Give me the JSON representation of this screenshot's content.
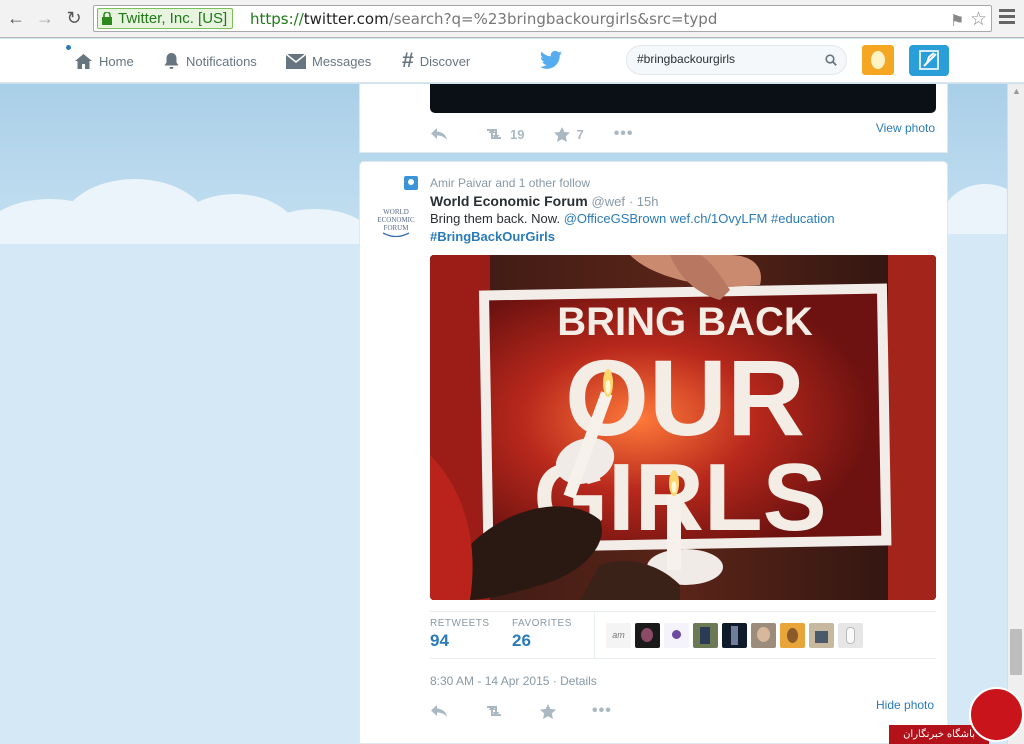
{
  "browser": {
    "ev_label": "Twitter, Inc. [US]",
    "url_scheme": "https://",
    "url_host": "twitter.com",
    "url_path": "/search?q=%23bringbackourgirls&src=typd",
    "back_icon": "back-arrow-icon",
    "forward_icon": "forward-arrow-icon",
    "reload_icon": "reload-icon"
  },
  "twitter_nav": {
    "items": [
      {
        "label": "Home",
        "icon": "home-icon"
      },
      {
        "label": "Notifications",
        "icon": "bell-icon"
      },
      {
        "label": "Messages",
        "icon": "envelope-icon"
      },
      {
        "label": "Discover",
        "icon": "hashtag-icon"
      }
    ],
    "search_value": "#bringbackourgirls",
    "brand_color": "#55acee",
    "compose_color": "#2a9ed8"
  },
  "tweet_prev": {
    "retweets": "19",
    "favorites": "7",
    "view_photo": "View photo"
  },
  "tweet": {
    "context": "Amir Paivar and 1 other follow",
    "logo_text": "WORLD ECONOMIC FORUM",
    "name": "World Economic Forum",
    "handle": "@wef",
    "time": "· 15h",
    "text_plain": "Bring them back. Now.",
    "mention": "@OfficeGSBrown",
    "link": "wef.ch/1OvyLFM",
    "hashtag1": "#education",
    "hashtag2": "#BringBackOurGirls",
    "photo_sign_line1": "BRING BACK",
    "photo_sign_line2": "OUR",
    "photo_sign_line3": "GIRLS",
    "retweets_label": "RETWEETS",
    "retweets": "94",
    "favorites_label": "FAVORITES",
    "favorites": "26",
    "timestamp": "8:30 AM - 14 Apr 2015",
    "details": "· Details",
    "hide_photo": "Hide photo"
  },
  "watermark": {
    "text": "باشگاه خبرنگاران"
  }
}
